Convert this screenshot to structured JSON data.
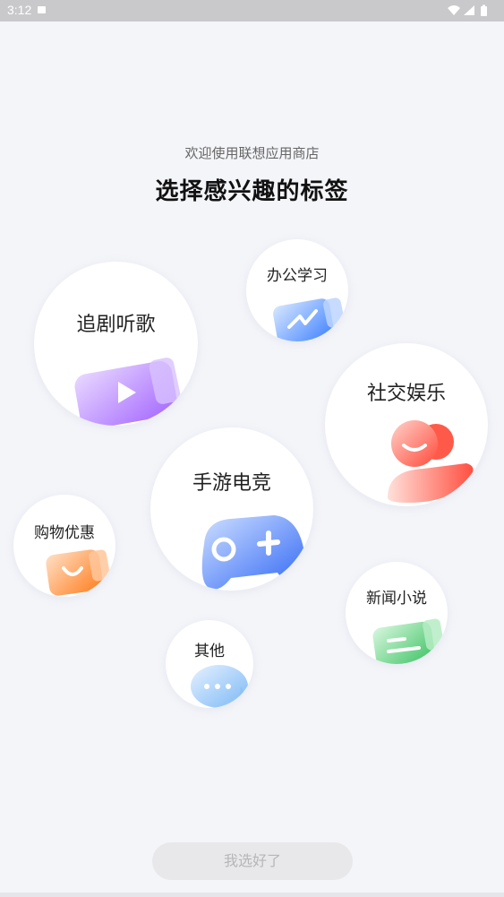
{
  "status_bar": {
    "time": "3:12"
  },
  "header": {
    "subtitle": "欢迎使用联想应用商店",
    "title": "选择感兴趣的标签"
  },
  "tags": [
    {
      "label": "追剧听歌",
      "icon": "play-video-icon",
      "color": "#a56bff"
    },
    {
      "label": "办公学习",
      "icon": "chart-folder-icon",
      "color": "#4d8dff"
    },
    {
      "label": "社交娱乐",
      "icon": "person-icon",
      "color": "#ff6050"
    },
    {
      "label": "手游电竞",
      "icon": "gamepad-icon",
      "color": "#3f6ef7"
    },
    {
      "label": "购物优惠",
      "icon": "shopping-bag-icon",
      "color": "#ff8a2a"
    },
    {
      "label": "新闻小说",
      "icon": "news-icon",
      "color": "#47c96a"
    },
    {
      "label": "其他",
      "icon": "more-chat-icon",
      "color": "#5aaaf5"
    }
  ],
  "confirm_button": {
    "label": "我选好了"
  }
}
